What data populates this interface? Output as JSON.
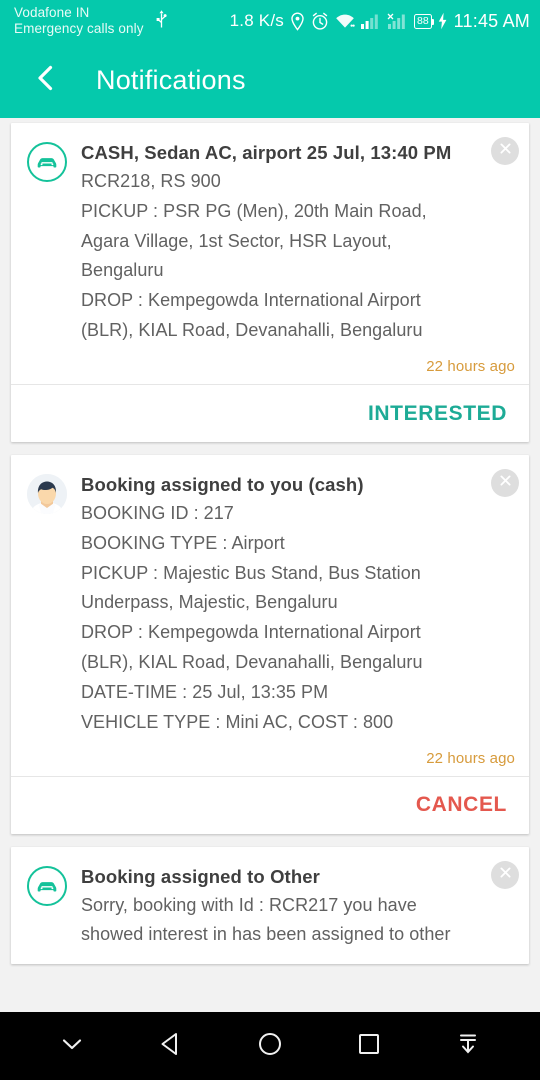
{
  "status_bar": {
    "carrier_line1": "Vodafone IN",
    "carrier_line2": "Emergency calls only",
    "usb_icon": "usb-icon",
    "network_speed": "1.8 K/s",
    "location_icon": "location-pin-icon",
    "alarm_icon": "alarm-clock-icon",
    "wifi_icon": "wifi-icon",
    "signal_icon_1": "signal-bars-icon",
    "signal_icon_2": "signal-bars-no-service-icon",
    "battery_level": "88",
    "charging_icon": "charging-bolt-icon",
    "time": "11:45 AM"
  },
  "app_bar": {
    "back_icon": "back-chevron-icon",
    "title": "Notifications"
  },
  "colors": {
    "accent_teal": "#05c9ac",
    "interested_green": "#1dab96",
    "cancel_red": "#e4584e",
    "timestamp_amber": "#d79b3c",
    "background": "#f2f2f2"
  },
  "notifications": [
    {
      "icon": "car-circle-icon",
      "title": "CASH, Sedan AC, airport 25 Jul, 13:40 PM",
      "lines": [
        "RCR218, RS 900",
        "PICKUP : PSR PG (Men), 20th Main Road, Agara Village, 1st Sector, HSR Layout, Bengaluru",
        "DROP : Kempegowda International Airport (BLR), KIAL Road, Devanahalli, Bengaluru"
      ],
      "timestamp": "22 hours ago",
      "action_label": "INTERESTED",
      "action_type": "interested",
      "close_icon": "close-circle-icon"
    },
    {
      "icon": "person-avatar-icon",
      "title": "Booking assigned to you (cash)",
      "lines": [
        "BOOKING ID : 217",
        "BOOKING TYPE : Airport",
        "PICKUP : Majestic Bus Stand, Bus Station Underpass, Majestic, Bengaluru",
        "DROP : Kempegowda International Airport (BLR), KIAL Road, Devanahalli, Bengaluru",
        "DATE-TIME : 25 Jul, 13:35 PM",
        "VEHICLE TYPE : Mini AC, COST : 800"
      ],
      "timestamp": "22 hours ago",
      "action_label": "CANCEL",
      "action_type": "cancel",
      "close_icon": "close-circle-icon"
    },
    {
      "icon": "car-circle-icon",
      "title": "Booking assigned to Other",
      "lines": [
        "Sorry, booking with Id : RCR217 you have showed interest in has been assigned to other"
      ],
      "timestamp": "",
      "action_label": "",
      "action_type": "",
      "close_icon": "close-circle-icon"
    }
  ],
  "nav_bar": {
    "hide_icon": "chevron-down-icon",
    "back_icon": "back-triangle-icon",
    "home_icon": "home-circle-icon",
    "recents_icon": "recents-square-icon",
    "collapse_icon": "collapse-down-arrow-icon"
  }
}
